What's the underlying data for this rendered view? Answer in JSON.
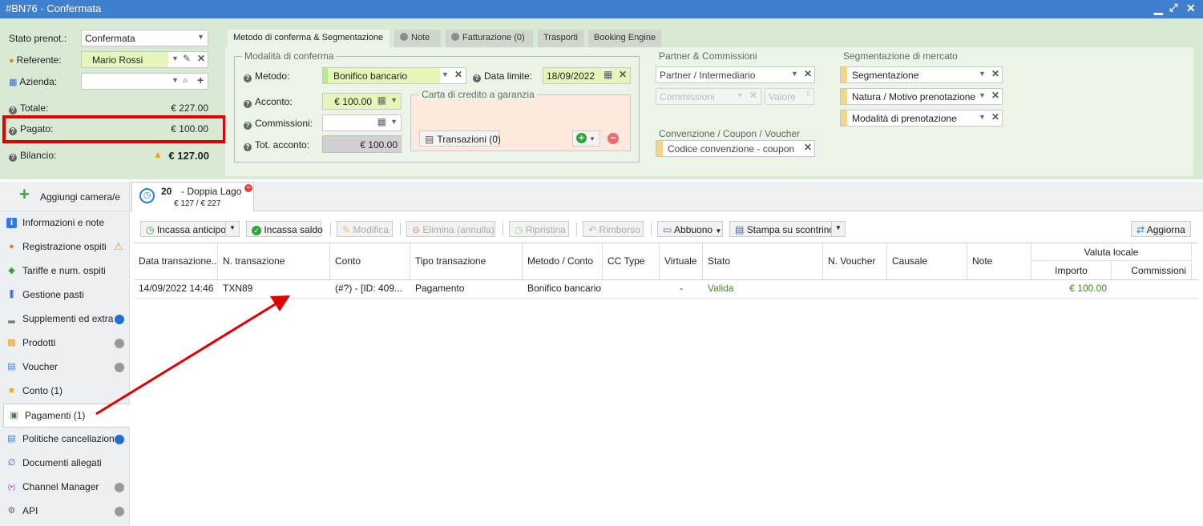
{
  "window": {
    "title": "#BN76 - Confermata"
  },
  "left_form": {
    "stato_label": "Stato prenot.:",
    "stato_value": "Confermata",
    "referente_label": "Referente:",
    "referente_value": "Mario Rossi",
    "azienda_label": "Azienda:",
    "azienda_value": "",
    "totale_label": "Totale:",
    "totale_value": "€ 227.00",
    "pagato_label": "Pagato:",
    "pagato_value": "€ 100.00",
    "bilancio_label": "Bilancio:",
    "bilancio_value": "€ 127.00"
  },
  "tabs": [
    {
      "label": "Metodo di conferma & Segmentazione"
    },
    {
      "label": "Note"
    },
    {
      "label": "Fatturazione (0)"
    },
    {
      "label": "Trasporti"
    },
    {
      "label": "Booking Engine"
    }
  ],
  "conferma": {
    "section_title": "Modalità di conferma",
    "metodo_label": "Metodo:",
    "metodo_value": "Bonifico bancario",
    "data_limite_label": "Data limite:",
    "data_limite_value": "18/09/2022",
    "acconto_label": "Acconto:",
    "acconto_value": "€ 100.00",
    "commissioni_label": "Commissioni:",
    "commissioni_value": "",
    "tot_acconto_label": "Tot. acconto:",
    "tot_acconto_value": "€ 100.00",
    "carta_title": "Carta di credito a garanzia",
    "transazioni_label": "Transazioni (0)"
  },
  "partner": {
    "title": "Partner & Commissioni",
    "partner_placeholder": "Partner / Intermediario",
    "commissioni_placeholder": "Commissioni",
    "valore_placeholder": "Valore",
    "convenzione_title": "Convenzione / Coupon / Voucher",
    "codice_placeholder": "Codice convenzione - coupon"
  },
  "segmentazione": {
    "title": "Segmentazione di mercato",
    "fields": [
      "Segmentazione",
      "Natura / Motivo prenotazione",
      "Modalità di prenotazione"
    ]
  },
  "sidebar": {
    "add_room_label": "Aggiungi camera/e",
    "items": [
      {
        "label": "Informazioni e note",
        "badge": ""
      },
      {
        "label": "Registrazione ospiti",
        "badge": "warning"
      },
      {
        "label": "Tariffe e num. ospiti",
        "badge": ""
      },
      {
        "label": "Gestione pasti",
        "badge": ""
      },
      {
        "label": "Supplementi ed extra",
        "badge": "blue"
      },
      {
        "label": "Prodotti",
        "badge": "grey"
      },
      {
        "label": "Voucher",
        "badge": "grey"
      },
      {
        "label": "Conto (1)",
        "badge": ""
      },
      {
        "label": "Pagamenti (1)",
        "badge": ""
      },
      {
        "label": "Politiche cancellazione",
        "badge": "blue"
      },
      {
        "label": "Documenti allegati",
        "badge": ""
      },
      {
        "label": "Channel Manager",
        "badge": "grey"
      },
      {
        "label": "API",
        "badge": "grey"
      }
    ]
  },
  "room_tab": {
    "number": "20",
    "name": "- Doppia Lago",
    "amounts": "€ 127 / € 227"
  },
  "toolbar": {
    "incassa_anticipo": "Incassa anticipo",
    "incassa_saldo": "Incassa saldo",
    "modifica": "Modifica",
    "elimina": "Elimina (annulla)",
    "ripristina": "Ripristina",
    "rimborso": "Rimborso",
    "abbuono": "Abbuono",
    "stampa": "Stampa su scontrino",
    "aggiorna": "Aggiorna"
  },
  "table": {
    "headers": [
      "Data transazione...",
      "N. transazione",
      "Conto",
      "Tipo transazione",
      "Metodo / Conto",
      "CC Type",
      "Virtuale",
      "Stato",
      "N. Voucher",
      "Causale",
      "Note"
    ],
    "group_header": "Valuta locale",
    "sub_headers": [
      "Importo",
      "Commissioni"
    ],
    "rows": [
      [
        "14/09/2022 14:46",
        "TXN89",
        "(#?) - [ID: 409...",
        "Pagamento",
        "Bonifico bancario",
        "",
        "-",
        "Valida",
        "",
        "",
        "",
        "€ 100.00",
        ""
      ]
    ]
  },
  "colors": {
    "titlebar": "#3f7fd0",
    "panel_green": "#d8ead3",
    "highlight_red": "#e00000",
    "status_valid": "#3f8a1e"
  }
}
